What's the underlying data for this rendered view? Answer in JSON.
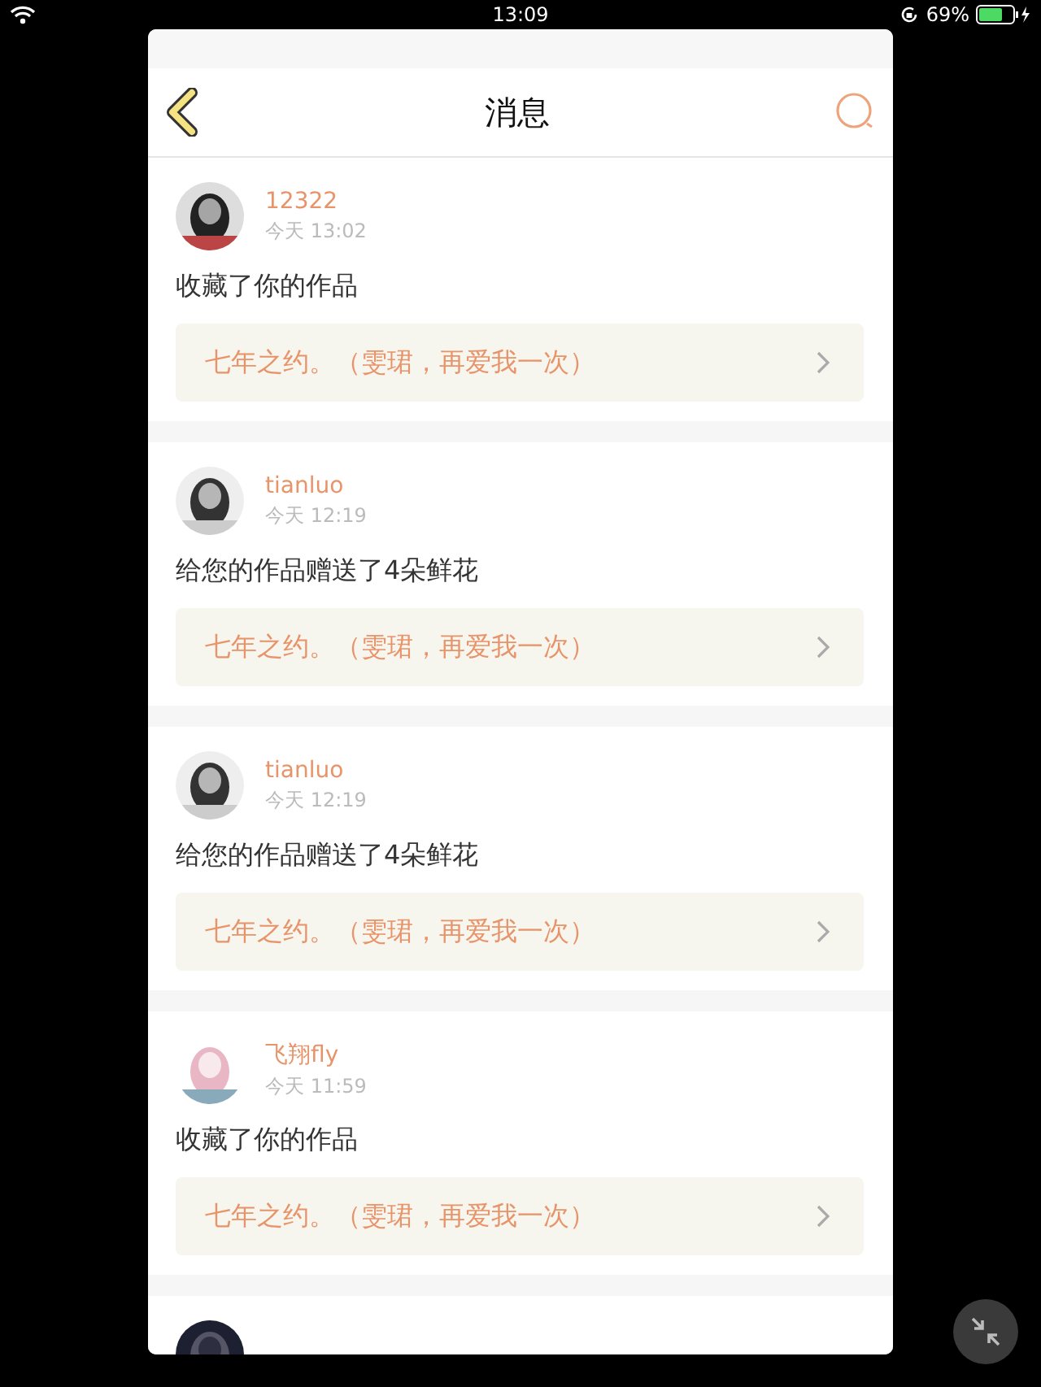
{
  "status_bar": {
    "time": "13:09",
    "battery": "69%"
  },
  "header": {
    "title": "消息"
  },
  "messages": [
    {
      "user": "12322",
      "time": "今天 13:02",
      "action": "收藏了你的作品",
      "work": "七年之约。（雯珺，再爱我一次）",
      "avatar": {
        "kind": "picture"
      }
    },
    {
      "user": "tianluo",
      "time": "今天 12:19",
      "action": "给您的作品赠送了4朵鲜花",
      "work": "七年之约。（雯珺，再爱我一次）",
      "avatar": {
        "kind": "picture"
      }
    },
    {
      "user": "tianluo",
      "time": "今天 12:19",
      "action": "给您的作品赠送了4朵鲜花",
      "work": "七年之约。（雯珺，再爱我一次）",
      "avatar": {
        "kind": "picture"
      }
    },
    {
      "user": "飞翔fly",
      "time": "今天 11:59",
      "action": "收藏了你的作品",
      "work": "七年之约。（雯珺，再爱我一次）",
      "avatar": {
        "kind": "picture"
      }
    },
    {
      "avatar": {
        "kind": "picture"
      }
    }
  ]
}
